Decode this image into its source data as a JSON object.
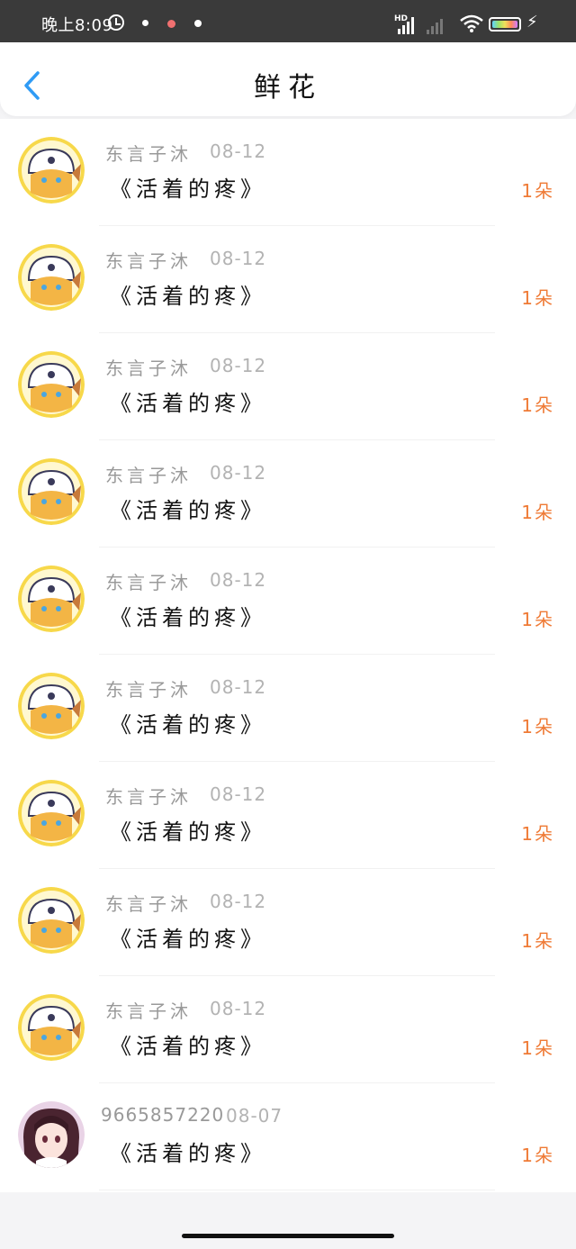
{
  "status_bar": {
    "time": "晚上8:09",
    "network_label": "HD",
    "battery_icon": "battery-charging-icon",
    "wifi_icon": "wifi-icon"
  },
  "header": {
    "title": "鲜花",
    "back_icon": "chevron-left-icon",
    "accent_color": "#2f9bf5"
  },
  "flowers": {
    "items": [
      {
        "avatar": "anime-fox-girl-avatar",
        "name": "东言子沐",
        "date": "08-12",
        "title": "《活着的疼》",
        "count": "1朵"
      },
      {
        "avatar": "anime-fox-girl-avatar",
        "name": "东言子沐",
        "date": "08-12",
        "title": "《活着的疼》",
        "count": "1朵"
      },
      {
        "avatar": "anime-fox-girl-avatar",
        "name": "东言子沐",
        "date": "08-12",
        "title": "《活着的疼》",
        "count": "1朵"
      },
      {
        "avatar": "anime-fox-girl-avatar",
        "name": "东言子沐",
        "date": "08-12",
        "title": "《活着的疼》",
        "count": "1朵"
      },
      {
        "avatar": "anime-fox-girl-avatar",
        "name": "东言子沐",
        "date": "08-12",
        "title": "《活着的疼》",
        "count": "1朵"
      },
      {
        "avatar": "anime-fox-girl-avatar",
        "name": "东言子沐",
        "date": "08-12",
        "title": "《活着的疼》",
        "count": "1朵"
      },
      {
        "avatar": "anime-fox-girl-avatar",
        "name": "东言子沐",
        "date": "08-12",
        "title": "《活着的疼》",
        "count": "1朵"
      },
      {
        "avatar": "anime-fox-girl-avatar",
        "name": "东言子沐",
        "date": "08-12",
        "title": "《活着的疼》",
        "count": "1朵"
      },
      {
        "avatar": "anime-fox-girl-avatar",
        "name": "东言子沐",
        "date": "08-12",
        "title": "《活着的疼》",
        "count": "1朵"
      },
      {
        "avatar": "anime-dark-hair-girl-avatar",
        "name": "9665857220",
        "date": "08-07",
        "title": "《活着的疼》",
        "count": "1朵"
      }
    ],
    "count_color": "#ef7a35"
  }
}
